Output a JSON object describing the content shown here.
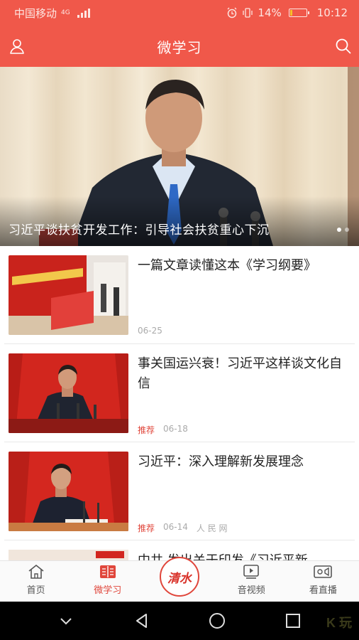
{
  "status_bar": {
    "carrier": "中国移动",
    "network": "4G",
    "battery": "14%",
    "battery_level": 0.14,
    "time": "10:12"
  },
  "header": {
    "title": "微学习",
    "left_icon": "user-icon",
    "right_icon": "search-icon"
  },
  "hero": {
    "caption": "习近平谈扶贫开发工作：引导社会扶贫重心下沉",
    "slide_count": 2,
    "active_slide": 1
  },
  "news": [
    {
      "title": "一篇文章读懂这本《学习纲要》",
      "tag": "",
      "date": "06-25",
      "source": ""
    },
    {
      "title": "事关国运兴衰！习近平这样谈文化自信",
      "tag": "推荐",
      "date": "06-18",
      "source": ""
    },
    {
      "title": "习近平：深入理解新发展理念",
      "tag": "推荐",
      "date": "06-14",
      "source": "人 民 网"
    }
  ],
  "partial_item": {
    "title": "中共 发出关于印发《习近平新"
  },
  "tabbar": {
    "tabs": [
      {
        "label": "首页",
        "icon": "home-icon",
        "active": false
      },
      {
        "label": "微学习",
        "icon": "book-icon",
        "active": true
      },
      {
        "label": "清水",
        "icon": "seal-icon",
        "active": false
      },
      {
        "label": "音视频",
        "icon": "video-play-icon",
        "active": false
      },
      {
        "label": "看直播",
        "icon": "camera-icon",
        "active": false
      }
    ]
  },
  "colors": {
    "brand_red": "#f0584a",
    "active_red": "#e0463b",
    "battery_yellow": "#f6c02b"
  },
  "watermark": "K 玩"
}
